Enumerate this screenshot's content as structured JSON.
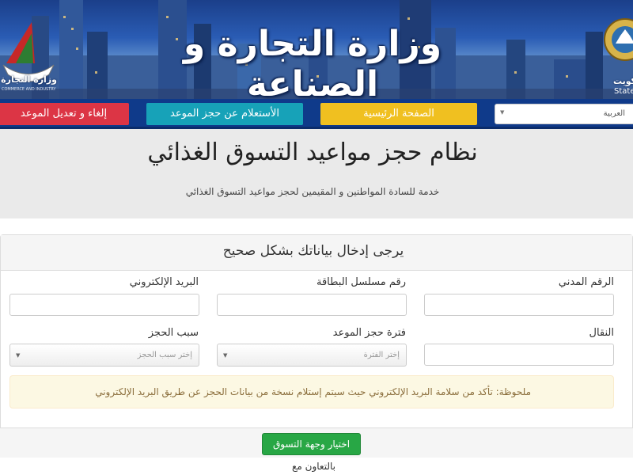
{
  "header": {
    "ministry_title": "وزارة التجارة و الصناعة",
    "left_logo_text": "وزارة التجارة و",
    "left_logo_subtext": "COMMERCE AND INDUSTRY",
    "right_logo_text": "الكويت",
    "right_logo_subtext": "State of"
  },
  "nav": {
    "cancel_label": "إلغاء و تعديل الموعد",
    "inquiry_label": "الأستعلام عن حجز الموعد",
    "home_label": "الصفحة الرئيسية",
    "language_selected": "العربية",
    "colors": {
      "cancel": "#dc3545",
      "inquiry": "#17a2b8",
      "home": "#f0c020",
      "bar": "#0f3a8a"
    }
  },
  "hero": {
    "title": "نظام حجز مواعيد التسوق الغذائي",
    "subtitle": "خدمة للسادة المواطنين و المقيمين لحجز مواعيد التسوق الغذائي"
  },
  "form": {
    "heading": "يرجى إدخال بياناتك بشكل صحيح",
    "labels": {
      "civil_id": "الرقم المدني",
      "card_serial": "رقم مسلسل البطاقة",
      "email": "البريد الإلكتروني",
      "mobile": "النقال",
      "slot": "فترة حجز الموعد",
      "reason": "سبب الحجز"
    },
    "values": {
      "civil_id": "",
      "card_serial": "",
      "email": "",
      "mobile": ""
    },
    "slot_placeholder": "إختر الفترة",
    "reason_placeholder": "إختر سبب الحجز",
    "note": "ملحوظة: تأكد من سلامة البريد الإلكتروني حيث سيتم إستلام نسخة من بيانات الحجز عن طريق البريد الإلكتروني",
    "submit_label": "اختيار وجهة التسوق",
    "submit_color": "#28a745"
  },
  "footer": {
    "cooperation_label": "بالتعاون مع"
  }
}
